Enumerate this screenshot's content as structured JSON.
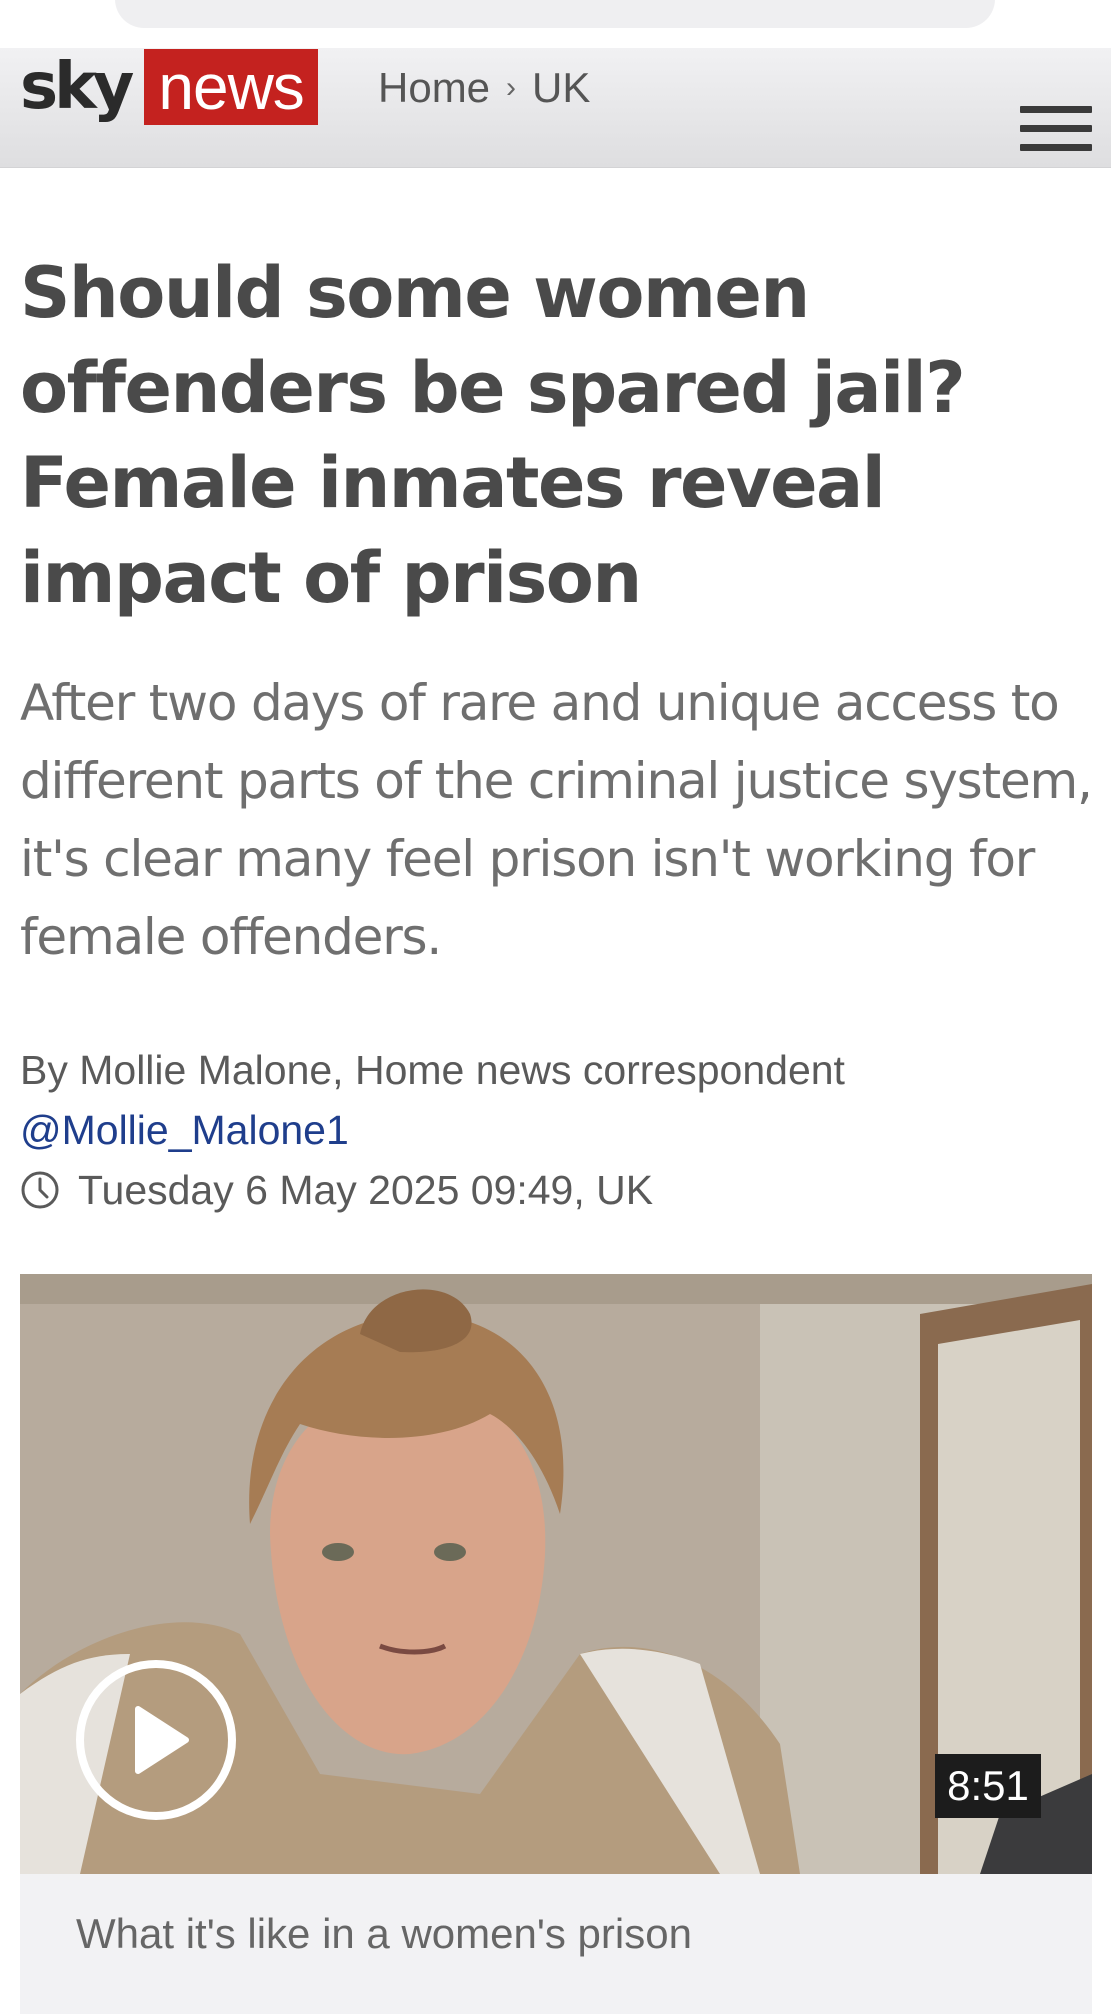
{
  "header": {
    "logo_sky": "sky",
    "logo_news": "news",
    "breadcrumb": {
      "home": "Home",
      "separator": "›",
      "section": "UK"
    },
    "menu_icon": "hamburger-menu-icon"
  },
  "article": {
    "headline": "Should some women offenders be spared jail? Female inmates reveal impact of prison",
    "standfirst": "After two days of rare and unique access to different parts of the criminal justice system, it's clear many feel prison isn't working for female offenders.",
    "byline": "By Mollie Malone, Home news correspondent",
    "twitter_handle": "@Mollie_Malone1",
    "timestamp": "Tuesday 6 May 2025 09:49, UK",
    "clock_icon": "clock-icon"
  },
  "video": {
    "duration": "8:51",
    "caption": "What it's like in a women's prison",
    "play_icon": "play-icon"
  },
  "colors": {
    "brand_red": "#c4221f",
    "link_blue": "#1f3e8c",
    "text_dark": "#4a4a4a",
    "text_muted": "#6f6f6f"
  }
}
